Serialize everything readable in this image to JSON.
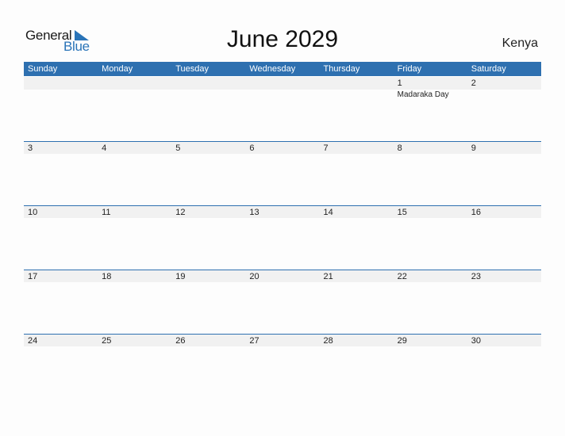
{
  "logo": {
    "line1": "General",
    "line2": "Blue"
  },
  "title": "June 2029",
  "country": "Kenya",
  "colors": {
    "accent": "#2e70b0",
    "strip": "#f1f1f1"
  },
  "weekdays": [
    "Sunday",
    "Monday",
    "Tuesday",
    "Wednesday",
    "Thursday",
    "Friday",
    "Saturday"
  ],
  "weeks": [
    {
      "days": [
        "",
        "",
        "",
        "",
        "",
        "1",
        "2"
      ],
      "events": [
        "",
        "",
        "",
        "",
        "",
        "Madaraka Day",
        ""
      ]
    },
    {
      "days": [
        "3",
        "4",
        "5",
        "6",
        "7",
        "8",
        "9"
      ],
      "events": [
        "",
        "",
        "",
        "",
        "",
        "",
        ""
      ]
    },
    {
      "days": [
        "10",
        "11",
        "12",
        "13",
        "14",
        "15",
        "16"
      ],
      "events": [
        "",
        "",
        "",
        "",
        "",
        "",
        ""
      ]
    },
    {
      "days": [
        "17",
        "18",
        "19",
        "20",
        "21",
        "22",
        "23"
      ],
      "events": [
        "",
        "",
        "",
        "",
        "",
        "",
        ""
      ]
    },
    {
      "days": [
        "24",
        "25",
        "26",
        "27",
        "28",
        "29",
        "30"
      ],
      "events": [
        "",
        "",
        "",
        "",
        "",
        "",
        ""
      ]
    }
  ]
}
